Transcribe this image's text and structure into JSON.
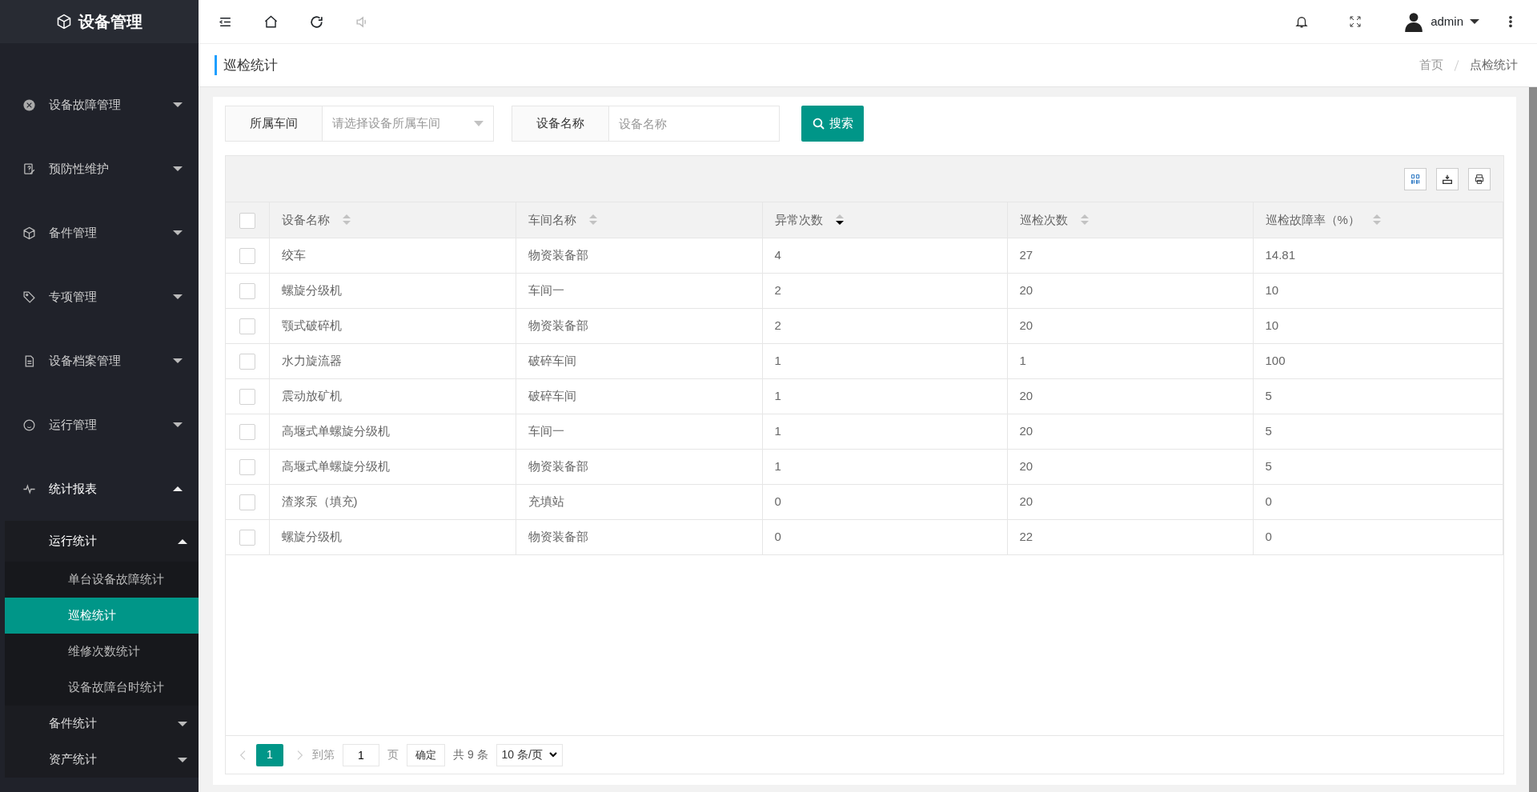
{
  "app": {
    "title": "设备管理"
  },
  "sidebar": {
    "items": [
      {
        "label": "设备故障管理",
        "expanded": false
      },
      {
        "label": "预防性维护",
        "expanded": false
      },
      {
        "label": "备件管理",
        "expanded": false
      },
      {
        "label": "专项管理",
        "expanded": false
      },
      {
        "label": "设备档案管理",
        "expanded": false
      },
      {
        "label": "运行管理",
        "expanded": false
      },
      {
        "label": "统计报表",
        "expanded": true,
        "children": [
          {
            "label": "运行统计",
            "expanded": true,
            "children": [
              {
                "label": "单台设备故障统计",
                "selected": false
              },
              {
                "label": "巡检统计",
                "selected": true
              },
              {
                "label": "维修次数统计",
                "selected": false
              },
              {
                "label": "设备故障台时统计",
                "selected": false
              }
            ]
          },
          {
            "label": "备件统计",
            "expanded": false
          },
          {
            "label": "资产统计",
            "expanded": false
          }
        ]
      }
    ]
  },
  "topbar": {
    "user": "admin"
  },
  "page": {
    "title": "巡检统计",
    "breadcrumb": [
      "首页",
      "点检统计"
    ]
  },
  "filters": [
    {
      "kind": "select",
      "label": "所属车间",
      "placeholder": "请选择设备所属车间"
    },
    {
      "kind": "text",
      "label": "设备名称",
      "placeholder": "设备名称"
    }
  ],
  "search_button": "搜索",
  "table": {
    "all_checked": false,
    "columns": [
      {
        "label": "设备名称",
        "sorted_descending": false
      },
      {
        "label": "车间名称",
        "sorted_descending": false
      },
      {
        "label": "异常次数",
        "sorted_descending": true
      },
      {
        "label": "巡检次数",
        "sorted_descending": false
      },
      {
        "label": "巡检故障率（%）",
        "sorted_descending": false
      }
    ],
    "rows": [
      {
        "checked": false,
        "cells": [
          "绞车",
          "物资装备部",
          "4",
          "27",
          "14.81"
        ]
      },
      {
        "checked": false,
        "cells": [
          "螺旋分级机",
          "车间一",
          "2",
          "20",
          "10"
        ]
      },
      {
        "checked": false,
        "cells": [
          "颚式破碎机",
          "物资装备部",
          "2",
          "20",
          "10"
        ]
      },
      {
        "checked": false,
        "cells": [
          "水力旋流器",
          "破碎车间",
          "1",
          "1",
          "100"
        ]
      },
      {
        "checked": false,
        "cells": [
          "震动放矿机",
          "破碎车间",
          "1",
          "20",
          "5"
        ]
      },
      {
        "checked": false,
        "cells": [
          "高堰式单螺旋分级机",
          "车间一",
          "1",
          "20",
          "5"
        ]
      },
      {
        "checked": false,
        "cells": [
          "高堰式单螺旋分级机",
          "物资装备部",
          "1",
          "20",
          "5"
        ]
      },
      {
        "checked": false,
        "cells": [
          "渣浆泵（填充)",
          "充填站",
          "0",
          "20",
          "0"
        ]
      },
      {
        "checked": false,
        "cells": [
          "螺旋分级机",
          "物资装备部",
          "0",
          "22",
          "0"
        ]
      }
    ]
  },
  "pagination": {
    "pages": [
      {
        "label": "1",
        "selected": true
      }
    ],
    "goto_label": "到第",
    "goto_value": "1",
    "page_unit": "页",
    "confirm": "确定",
    "total": "共 9 条",
    "page_size": "10 条/页"
  }
}
